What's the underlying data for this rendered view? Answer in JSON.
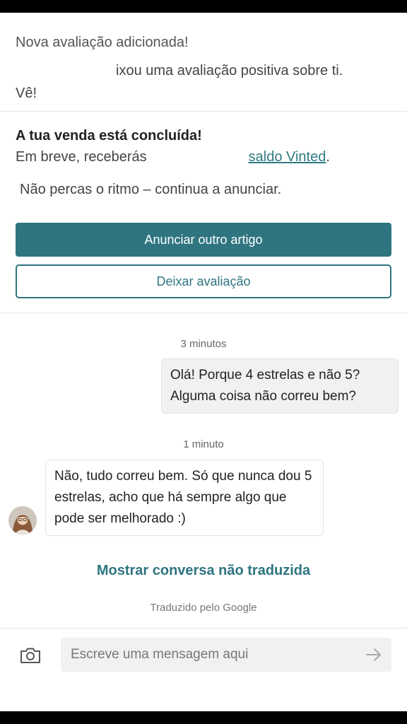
{
  "notifications": {
    "review": {
      "title": "Nova avaliação adicionada!",
      "text": "ixou uma avaliação positiva sobre ti.",
      "link": "Vê!"
    },
    "sale": {
      "title": "A tua venda está concluída!",
      "text_start": "Em breve, receberás",
      "text_link": "saldo Vinted",
      "text_end": ".",
      "motivation": "Não percas o ritmo – continua a anunciar."
    }
  },
  "actions": {
    "primary_label": "Anunciar outro artigo",
    "secondary_label": "Deixar avaliação"
  },
  "messages": [
    {
      "time": "3 minutos",
      "direction": "outgoing",
      "text": "Olá! Porque 4 estrelas e não 5? Alguma coisa não correu bem?"
    },
    {
      "time": "1 minuto",
      "direction": "incoming",
      "text": "Não, tudo correu bem. Só que nunca dou 5 estrelas, acho que há sempre algo que pode ser melhorado :)"
    }
  ],
  "translation": {
    "show_original": "Mostrar conversa não traduzida",
    "translated_by": "Traduzido pelo Google"
  },
  "composer": {
    "placeholder": "Escreve uma mensagem aqui",
    "camera_icon": "camera-icon",
    "send_icon": "arrow-right-icon"
  },
  "colors": {
    "accent": "#2e7580",
    "bubble_out": "#f1f1f1"
  }
}
